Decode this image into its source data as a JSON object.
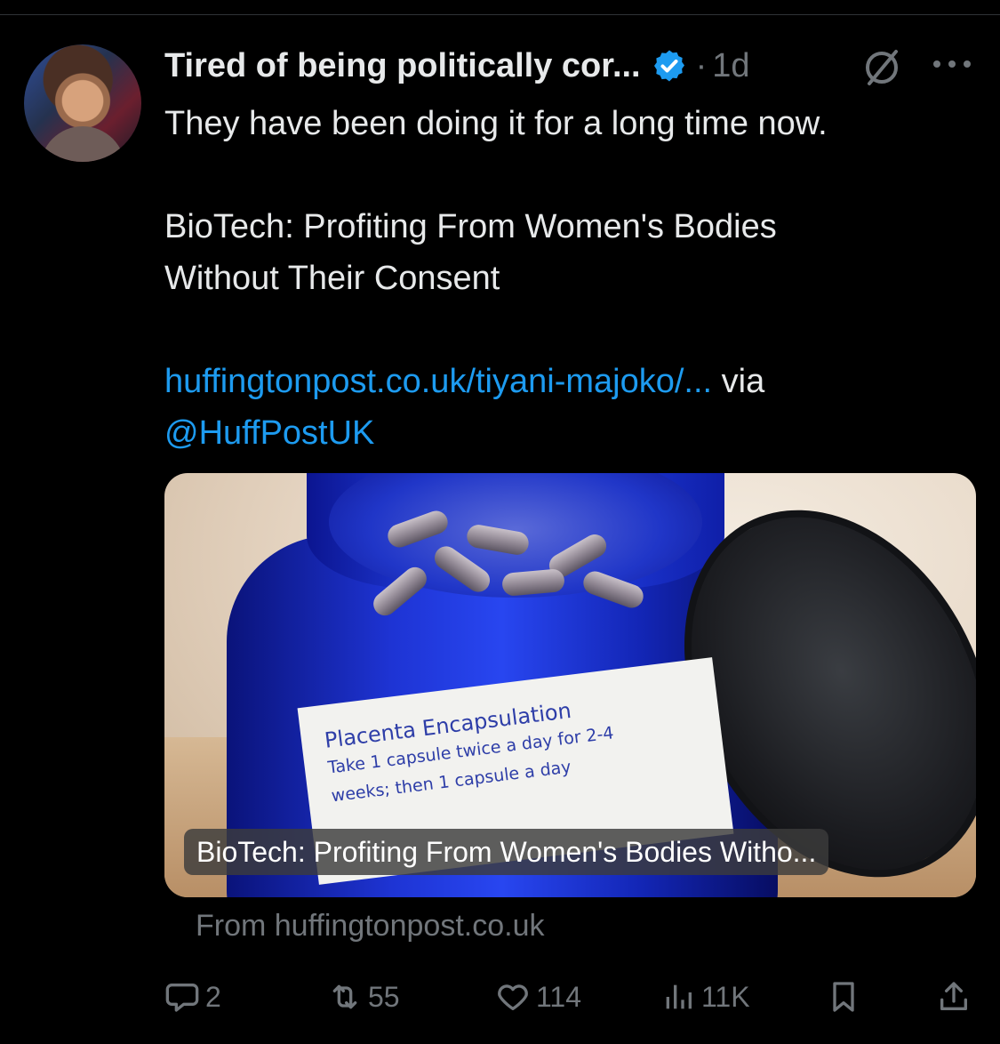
{
  "tweet": {
    "author_name": "Tired of being politically cor...",
    "separator": "·",
    "time": "1d",
    "text_line1": "They have been doing it for a long time now.",
    "text_line2": "BioTech: Profiting From Women's Bodies",
    "text_line3": "Without Their Consent",
    "link_text": "huffingtonpost.co.uk/tiyani-majoko/...",
    "via_text": " via",
    "mention": "@HuffPostUK"
  },
  "card": {
    "caption": "BioTech: Profiting From Women's Bodies Witho...",
    "source": "From huffingtonpost.co.uk",
    "image_label_line1": "Placenta Encapsulation",
    "image_label_line2": "Take 1 capsule twice a day for 2-4",
    "image_label_line3": "weeks; then 1 capsule a day"
  },
  "actions": {
    "replies": "2",
    "reposts": "55",
    "likes": "114",
    "views": "11K"
  },
  "colors": {
    "background": "#000000",
    "text": "#e7e9ea",
    "muted": "#71767b",
    "link": "#1d9bf0",
    "verified": "#1d9bf0"
  },
  "icons": [
    "verified-badge-icon",
    "grok-icon",
    "more-icon",
    "reply-icon",
    "repost-icon",
    "like-icon",
    "views-icon",
    "bookmark-icon",
    "share-icon"
  ]
}
